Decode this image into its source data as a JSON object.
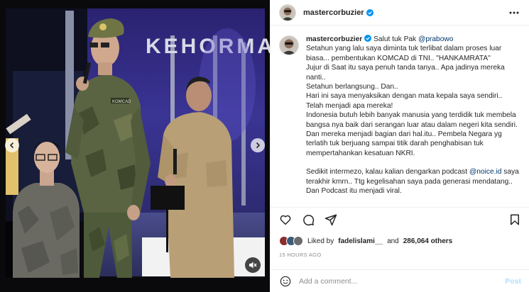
{
  "media": {
    "stage_banner_text": "KEHORMA",
    "uniform_name_tag": "KOMCAD",
    "icons": {
      "prev": "chevron-left-icon",
      "next": "chevron-right-icon",
      "audio": "muted-speaker-icon"
    }
  },
  "header": {
    "username": "mastercorbuzier",
    "verified": true,
    "more_icon": "more-horizontal-icon"
  },
  "caption": {
    "username": "mastercorbuzier",
    "intro": "Salut tuk Pak ",
    "mention_prabowo": "@prabowo",
    "line1": "Setahun yang lalu saya diminta tuk terlibat dalam proses luar biasa... pembentukan KOMCAD di TNI.. \"HANKAMRATA\"",
    "line2": "Jujur di Saat itu saya penuh tanda tanya.. Apa jadinya mereka nanti..",
    "line3": "Setahun berlangsung.. Dan..",
    "line4": "Hari ini saya menyaksikan dengan mata kepala saya sendiri..",
    "line5": "Telah menjadi apa mereka!",
    "line6": "Indonesia butuh lebih banyak manusia yang terdidik tuk membela bangsa nya baik dari serangan luar atau dalam negeri kita sendiri.",
    "line7": "Dan mereka menjadi bagian dari hal.itu.. Pembela Negara yg terlatih tuk berjuang sampai titik darah penghabisan tuk mempertahankan kesatuan NKRI.",
    "line8_a": "Sedikit intermezo, kalau kalian dengarkan podcast ",
    "mention_noice": "@noice.id",
    "line8_b": " saya terakhir kmrn.. Ttg kegelisahan saya pada generasi mendatang.. Dan Podcast itu menjadi viral."
  },
  "actions": {
    "like_icon": "heart-icon",
    "comment_icon": "comment-icon",
    "share_icon": "send-icon",
    "save_icon": "bookmark-icon"
  },
  "likes": {
    "prefix": "Liked by",
    "first_liker": "fadelislami__",
    "conjunction": "and",
    "others": "286,064 others",
    "avatar_colors": [
      "#8a2c2c",
      "#3b5b7a",
      "#6b6b6b"
    ]
  },
  "timestamp": "15 HOURS AGO",
  "comment_box": {
    "emoji_icon": "smiley-icon",
    "placeholder": "Add a comment...",
    "post_label": "Post"
  },
  "colors": {
    "link": "#00376b",
    "verified": "#0095f6",
    "post_disabled": "#b2dffc",
    "muted_text": "#8e8e8e"
  }
}
